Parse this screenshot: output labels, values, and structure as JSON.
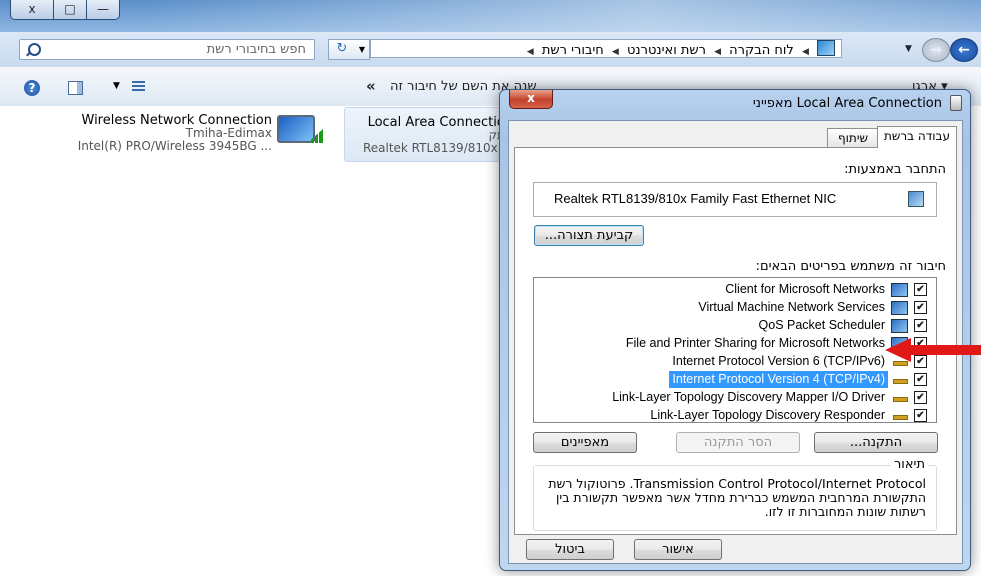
{
  "explorer": {
    "titlebar": {
      "close": "x",
      "maximize": "□",
      "minimize": "—"
    },
    "search": {
      "placeholder": "חפש בחיבורי רשת"
    },
    "breadcrumb": [
      "לוח הבקרה",
      "רשת ואינטרנט",
      "חיבורי רשת"
    ],
    "toolbar": {
      "more": "«",
      "rename_cmd": "שנה את השם של חיבור זה",
      "organize": "ארגן ▾"
    },
    "connections": [
      {
        "name": "Wireless Network Connection",
        "status": "Tmiha-Edimax",
        "device": "Intel(R) PRO/Wireless 3945BG ..."
      },
      {
        "name": "Local Area Connection",
        "status": "נותק",
        "device": "Realtek RTL8139/810x ..."
      }
    ]
  },
  "dialog": {
    "title": "Local Area Connection מאפייני",
    "close": "x",
    "tabs": {
      "networking": "עבודה ברשת",
      "sharing": "שיתוף"
    },
    "connect_using_label": "התחבר באמצעות:",
    "adapter": "Realtek RTL8139/810x Family Fast Ethernet NIC",
    "configure_button": "קביעת תצורה...",
    "items_label": "חיבור זה משתמש בפריטים הבאים:",
    "items": [
      {
        "label": "Client for Microsoft Networks",
        "checked": "✔"
      },
      {
        "label": "Virtual Machine Network Services",
        "checked": "✔"
      },
      {
        "label": "QoS Packet Scheduler",
        "checked": "✔"
      },
      {
        "label": "File and Printer Sharing for Microsoft Networks",
        "checked": "✔"
      },
      {
        "label": "Internet Protocol Version 6 (TCP/IPv6)",
        "checked": "✔"
      },
      {
        "label": "Internet Protocol Version 4 (TCP/IPv4)",
        "checked": "✔"
      },
      {
        "label": "Link-Layer Topology Discovery Mapper I/O Driver",
        "checked": "✔"
      },
      {
        "label": "Link-Layer Topology Discovery Responder",
        "checked": "✔"
      }
    ],
    "install_button": "התקנה...",
    "uninstall_button": "הסר התקנה",
    "properties_button": "מאפיינים",
    "description_title": "תיאור",
    "description": "Transmission Control Protocol/Internet Protocol. פרוטוקול רשת התקשורת המרחבית המשמש כברירת מחדל אשר מאפשר תקשורת בין רשתות שונות המחוברות זו לזו.",
    "ok_button": "אישור",
    "cancel_button": "ביטול"
  }
}
